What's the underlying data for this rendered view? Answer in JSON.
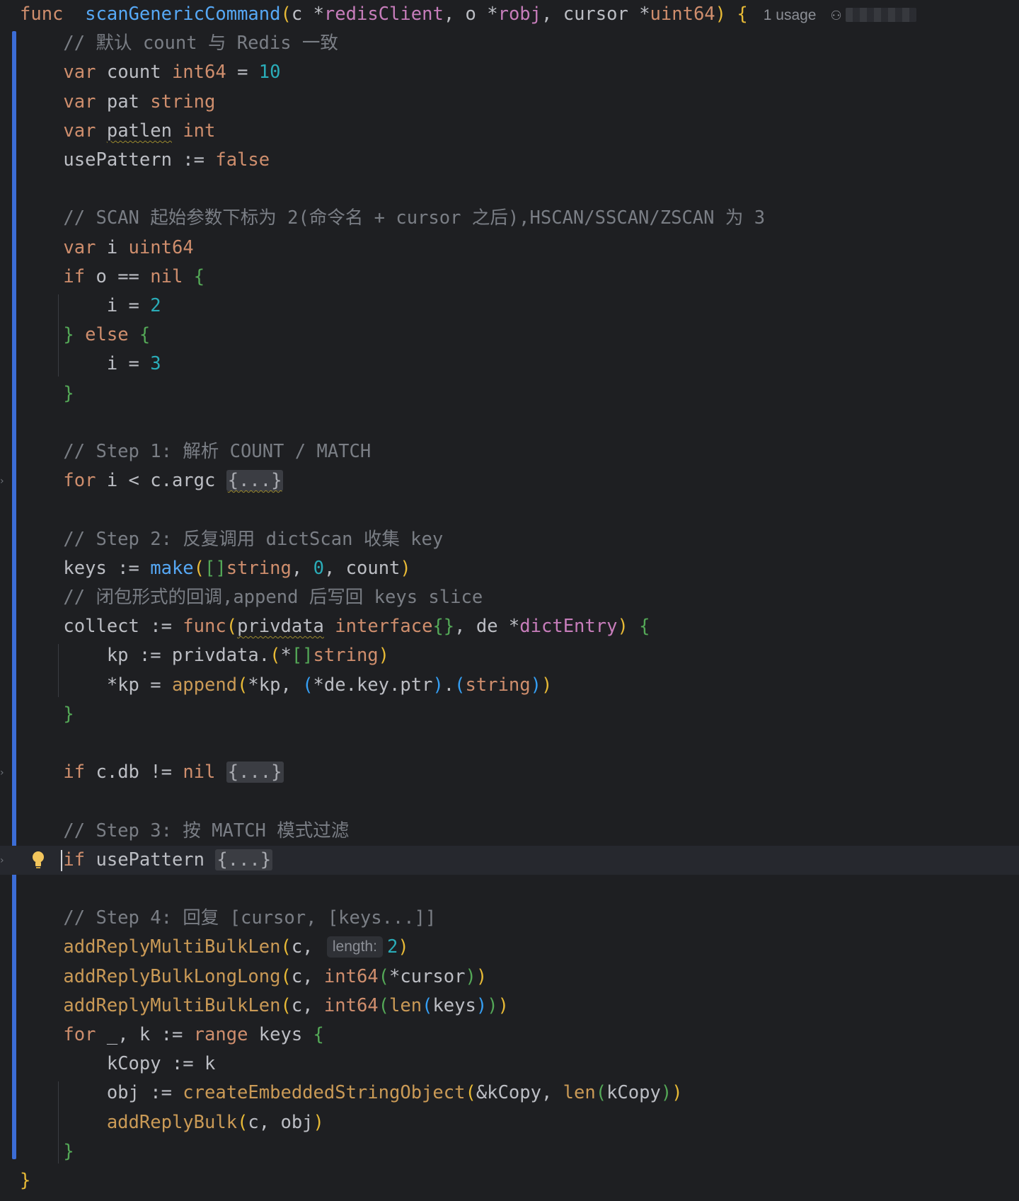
{
  "editor": {
    "usage_hint": "1 usage",
    "fold_placeholder": "{...}",
    "param_hint_length": "length:",
    "lines": [
      {
        "tokens": [
          [
            "kw",
            "func"
          ],
          [
            "",
            "  "
          ],
          [
            "fn",
            "scanGenericCommand"
          ],
          [
            "p1",
            "("
          ],
          [
            "",
            "c "
          ],
          [
            "",
            "*"
          ],
          [
            "type",
            "redisClient"
          ],
          [
            "",
            ", o "
          ],
          [
            "",
            "*"
          ],
          [
            "type",
            "robj"
          ],
          [
            "",
            ", cursor "
          ],
          [
            "",
            "*"
          ],
          [
            "btype",
            "uint64"
          ],
          [
            "p1",
            ")"
          ],
          [
            "",
            " "
          ],
          [
            "p1",
            "{"
          ]
        ]
      },
      {
        "tokens": [
          [
            "",
            "    "
          ],
          [
            "cmt",
            "// 默认 count 与 Redis 一致"
          ]
        ]
      },
      {
        "tokens": [
          [
            "",
            "    "
          ],
          [
            "kw",
            "var"
          ],
          [
            "",
            " count "
          ],
          [
            "btype",
            "int64"
          ],
          [
            "",
            " = "
          ],
          [
            "num",
            "10"
          ]
        ]
      },
      {
        "tokens": [
          [
            "",
            "    "
          ],
          [
            "kw",
            "var"
          ],
          [
            "",
            " pat "
          ],
          [
            "btype",
            "string"
          ]
        ]
      },
      {
        "tokens": [
          [
            "",
            "    "
          ],
          [
            "kw",
            "var"
          ],
          [
            "",
            " "
          ],
          [
            "wavy",
            "patlen"
          ],
          [
            "",
            " "
          ],
          [
            "btype",
            "int"
          ]
        ]
      },
      {
        "tokens": [
          [
            "",
            "    usePattern := "
          ],
          [
            "kw",
            "false"
          ]
        ]
      },
      {
        "tokens": []
      },
      {
        "tokens": [
          [
            "",
            "    "
          ],
          [
            "cmt",
            "// SCAN 起始参数下标为 2(命令名 + cursor 之后),HSCAN/SSCAN/ZSCAN 为 3"
          ]
        ]
      },
      {
        "tokens": [
          [
            "",
            "    "
          ],
          [
            "kw",
            "var"
          ],
          [
            "",
            " i "
          ],
          [
            "btype",
            "uint64"
          ]
        ]
      },
      {
        "tokens": [
          [
            "",
            "    "
          ],
          [
            "kw",
            "if"
          ],
          [
            "",
            " o == "
          ],
          [
            "kw",
            "nil"
          ],
          [
            "",
            " "
          ],
          [
            "p2",
            "{"
          ]
        ]
      },
      {
        "tokens": [
          [
            "",
            "        i = "
          ],
          [
            "num",
            "2"
          ]
        ]
      },
      {
        "tokens": [
          [
            "",
            "    "
          ],
          [
            "p2",
            "}"
          ],
          [
            "",
            " "
          ],
          [
            "kw",
            "else"
          ],
          [
            "",
            " "
          ],
          [
            "p2",
            "{"
          ]
        ]
      },
      {
        "tokens": [
          [
            "",
            "        i = "
          ],
          [
            "num",
            "3"
          ]
        ]
      },
      {
        "tokens": [
          [
            "",
            "    "
          ],
          [
            "p2",
            "}"
          ]
        ]
      },
      {
        "tokens": []
      },
      {
        "tokens": [
          [
            "",
            "    "
          ],
          [
            "cmt",
            "// Step 1: 解析 COUNT / MATCH"
          ]
        ]
      },
      {
        "tokens": [
          [
            "",
            "    "
          ],
          [
            "kw",
            "for"
          ],
          [
            "",
            " i < c.argc "
          ],
          [
            "foldw",
            "{...}"
          ]
        ]
      },
      {
        "tokens": []
      },
      {
        "tokens": [
          [
            "",
            "    "
          ],
          [
            "cmt",
            "// Step 2: 反复调用 dictScan 收集 key"
          ]
        ]
      },
      {
        "tokens": [
          [
            "",
            "    keys := "
          ],
          [
            "bi",
            "make"
          ],
          [
            "p1",
            "("
          ],
          [
            "p2",
            "[]"
          ],
          [
            "btype",
            "string"
          ],
          [
            "",
            ", "
          ],
          [
            "num",
            "0"
          ],
          [
            "",
            ", count"
          ],
          [
            "p1",
            ")"
          ]
        ]
      },
      {
        "tokens": [
          [
            "",
            "    "
          ],
          [
            "cmt",
            "// 闭包形式的回调,append 后写回 keys slice"
          ]
        ]
      },
      {
        "tokens": [
          [
            "",
            "    collect := "
          ],
          [
            "kw",
            "func"
          ],
          [
            "p1",
            "("
          ],
          [
            "wavy",
            "privdata"
          ],
          [
            "",
            " "
          ],
          [
            "btype",
            "interface"
          ],
          [
            "p2",
            "{}"
          ],
          [
            "",
            ", de *"
          ],
          [
            "type",
            "dictEntry"
          ],
          [
            "p1",
            ")"
          ],
          [
            "",
            " "
          ],
          [
            "p2",
            "{"
          ]
        ]
      },
      {
        "tokens": [
          [
            "",
            "        kp := privdata."
          ],
          [
            "p1",
            "("
          ],
          [
            "",
            "*"
          ],
          [
            "p2",
            "[]"
          ],
          [
            "btype",
            "string"
          ],
          [
            "p1",
            ")"
          ]
        ]
      },
      {
        "tokens": [
          [
            "",
            "        *kp = "
          ],
          [
            "call",
            "append"
          ],
          [
            "p1",
            "("
          ],
          [
            "",
            "*kp, "
          ],
          [
            "p3",
            "("
          ],
          [
            "",
            "*de.key.ptr"
          ],
          [
            "p3",
            ")"
          ],
          [
            "",
            "."
          ],
          [
            "p3",
            "("
          ],
          [
            "btype",
            "string"
          ],
          [
            "p3",
            ")"
          ],
          [
            "p1",
            ")"
          ]
        ]
      },
      {
        "tokens": [
          [
            "",
            "    "
          ],
          [
            "p2",
            "}"
          ]
        ]
      },
      {
        "tokens": []
      },
      {
        "tokens": [
          [
            "",
            "    "
          ],
          [
            "kw",
            "if"
          ],
          [
            "",
            " c.db != "
          ],
          [
            "kw",
            "nil"
          ],
          [
            "",
            " "
          ],
          [
            "fold",
            "{...}"
          ]
        ]
      },
      {
        "tokens": []
      },
      {
        "tokens": [
          [
            "",
            "    "
          ],
          [
            "cmt",
            "// Step 3: 按 MATCH 模式过滤"
          ]
        ]
      },
      {
        "tokens": [
          [
            "",
            "    "
          ],
          [
            "kw",
            "if"
          ],
          [
            "",
            " usePattern "
          ],
          [
            "fold",
            "{...}"
          ]
        ]
      },
      {
        "tokens": []
      },
      {
        "tokens": [
          [
            "",
            "    "
          ],
          [
            "cmt",
            "// Step 4: 回复 [cursor, [keys...]]"
          ]
        ]
      },
      {
        "tokens": [
          [
            "",
            "    "
          ],
          [
            "call",
            "addReplyMultiBulkLen"
          ],
          [
            "p1",
            "("
          ],
          [
            "",
            "c, "
          ],
          [
            "hint",
            "length:"
          ],
          [
            "num",
            "2"
          ],
          [
            "p1",
            ")"
          ]
        ]
      },
      {
        "tokens": [
          [
            "",
            "    "
          ],
          [
            "call",
            "addReplyBulkLongLong"
          ],
          [
            "p1",
            "("
          ],
          [
            "",
            "c, "
          ],
          [
            "btype",
            "int64"
          ],
          [
            "p2",
            "("
          ],
          [
            "",
            "*cursor"
          ],
          [
            "p2",
            ")"
          ],
          [
            "p1",
            ")"
          ]
        ]
      },
      {
        "tokens": [
          [
            "",
            "    "
          ],
          [
            "call",
            "addReplyMultiBulkLen"
          ],
          [
            "p1",
            "("
          ],
          [
            "",
            "c, "
          ],
          [
            "btype",
            "int64"
          ],
          [
            "p2",
            "("
          ],
          [
            "call",
            "len"
          ],
          [
            "p3",
            "("
          ],
          [
            "",
            "keys"
          ],
          [
            "p3",
            ")"
          ],
          [
            "p2",
            ")"
          ],
          [
            "p1",
            ")"
          ]
        ]
      },
      {
        "tokens": [
          [
            "",
            "    "
          ],
          [
            "kw",
            "for"
          ],
          [
            "",
            " _, k := "
          ],
          [
            "kw",
            "range"
          ],
          [
            "",
            " keys "
          ],
          [
            "p2",
            "{"
          ]
        ]
      },
      {
        "tokens": [
          [
            "",
            "        kCopy := k"
          ]
        ]
      },
      {
        "tokens": [
          [
            "",
            "        obj := "
          ],
          [
            "call",
            "createEmbeddedStringObject"
          ],
          [
            "p1",
            "("
          ],
          [
            "",
            "&kCopy, "
          ],
          [
            "call",
            "len"
          ],
          [
            "p2",
            "("
          ],
          [
            "",
            "kCopy"
          ],
          [
            "p2",
            ")"
          ],
          [
            "p1",
            ")"
          ]
        ]
      },
      {
        "tokens": [
          [
            "",
            "        "
          ],
          [
            "call",
            "addReplyBulk"
          ],
          [
            "p1",
            "("
          ],
          [
            "",
            "c, obj"
          ],
          [
            "p1",
            ")"
          ]
        ]
      },
      {
        "tokens": [
          [
            "",
            "    "
          ],
          [
            "p2",
            "}"
          ]
        ]
      },
      {
        "tokens": [
          [
            "p1",
            "}"
          ]
        ]
      }
    ]
  }
}
